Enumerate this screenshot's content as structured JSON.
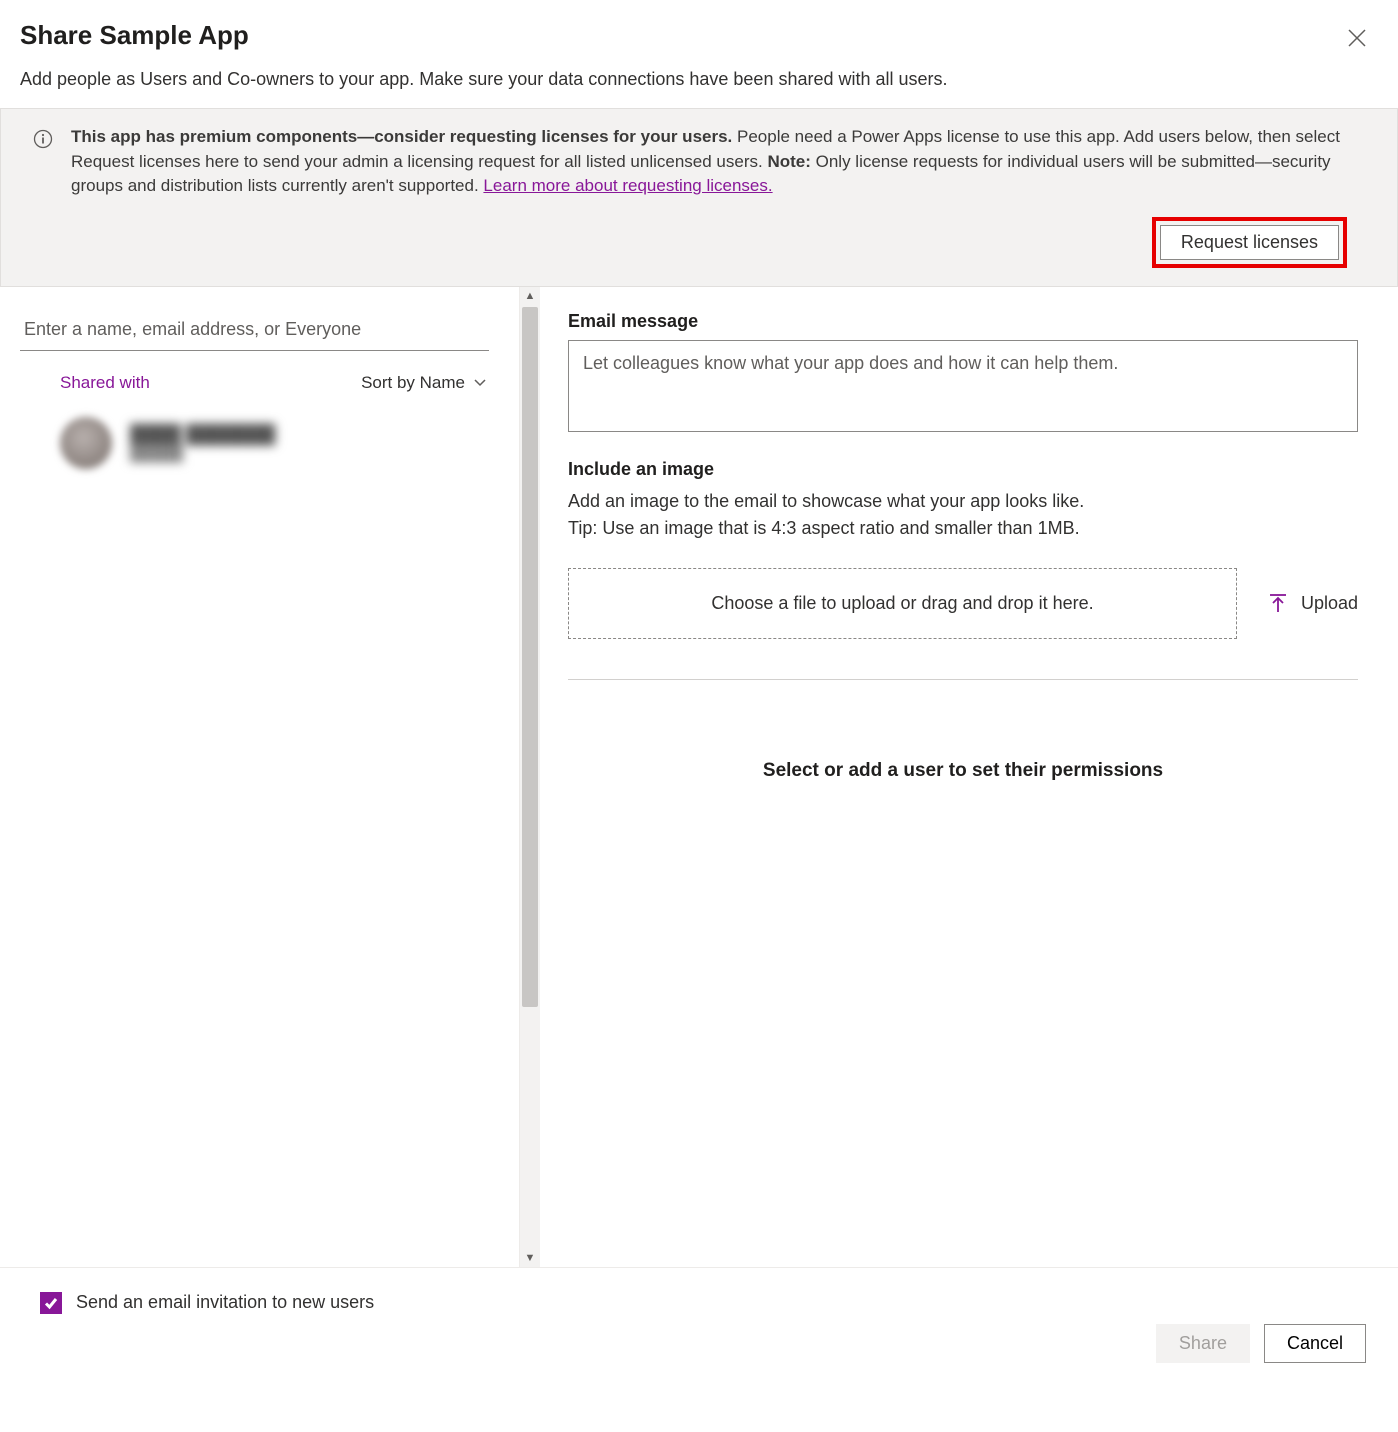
{
  "header": {
    "title": "Share Sample App",
    "subtitle": "Add people as Users and Co-owners to your app. Make sure your data connections have been shared with all users."
  },
  "banner": {
    "bold_lead": "This app has premium components—consider requesting licenses for your users.",
    "text_1": " People need a Power Apps license to use this app. Add users below, then select Request licenses here to send your admin a licensing request for all listed unlicensed users. ",
    "note_label": "Note:",
    "text_2": " Only license requests for individual users will be submitted—security groups and distribution lists currently aren't supported. ",
    "learn_link": "Learn more about requesting licenses.",
    "request_button": "Request licenses"
  },
  "left": {
    "search_placeholder": "Enter a name, email address, or Everyone",
    "shared_with": "Shared with",
    "sort_by": "Sort by Name",
    "user": {
      "name": "████ ███████",
      "role": "█████"
    }
  },
  "right": {
    "email_label": "Email message",
    "email_placeholder": "Let colleagues know what your app does and how it can help them.",
    "image_label": "Include an image",
    "image_help_1": "Add an image to the email to showcase what your app looks like.",
    "image_help_2": "Tip: Use an image that is 4:3 aspect ratio and smaller than 1MB.",
    "dropzone": "Choose a file to upload or drag and drop it here.",
    "upload": "Upload",
    "select_prompt": "Select or add a user to set their permissions"
  },
  "footer": {
    "checkbox_label": "Send an email invitation to new users",
    "share": "Share",
    "cancel": "Cancel"
  }
}
